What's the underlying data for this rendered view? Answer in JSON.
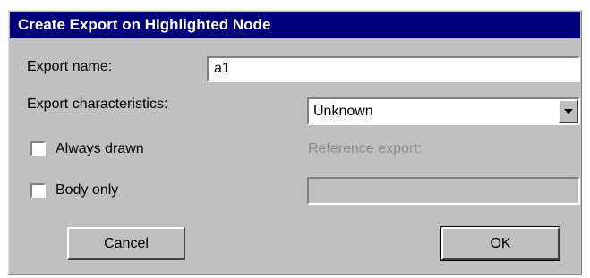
{
  "dialog": {
    "title": "Create Export on Highlighted Node"
  },
  "export_name": {
    "label": "Export name:",
    "value": "a1"
  },
  "characteristics": {
    "label": "Export characteristics:",
    "selected": "Unknown"
  },
  "always_drawn": {
    "label": "Always drawn",
    "checked": false
  },
  "body_only": {
    "label": "Body only",
    "checked": false
  },
  "reference_export": {
    "label": "Reference export:",
    "value": ""
  },
  "buttons": {
    "cancel": "Cancel",
    "ok": "OK"
  },
  "colors": {
    "title_bar": "#00007b",
    "dialog_face": "#c0c0c0",
    "disabled_text": "#8a8a8a"
  },
  "icons": {
    "dropdown": "chevron-down-icon"
  }
}
